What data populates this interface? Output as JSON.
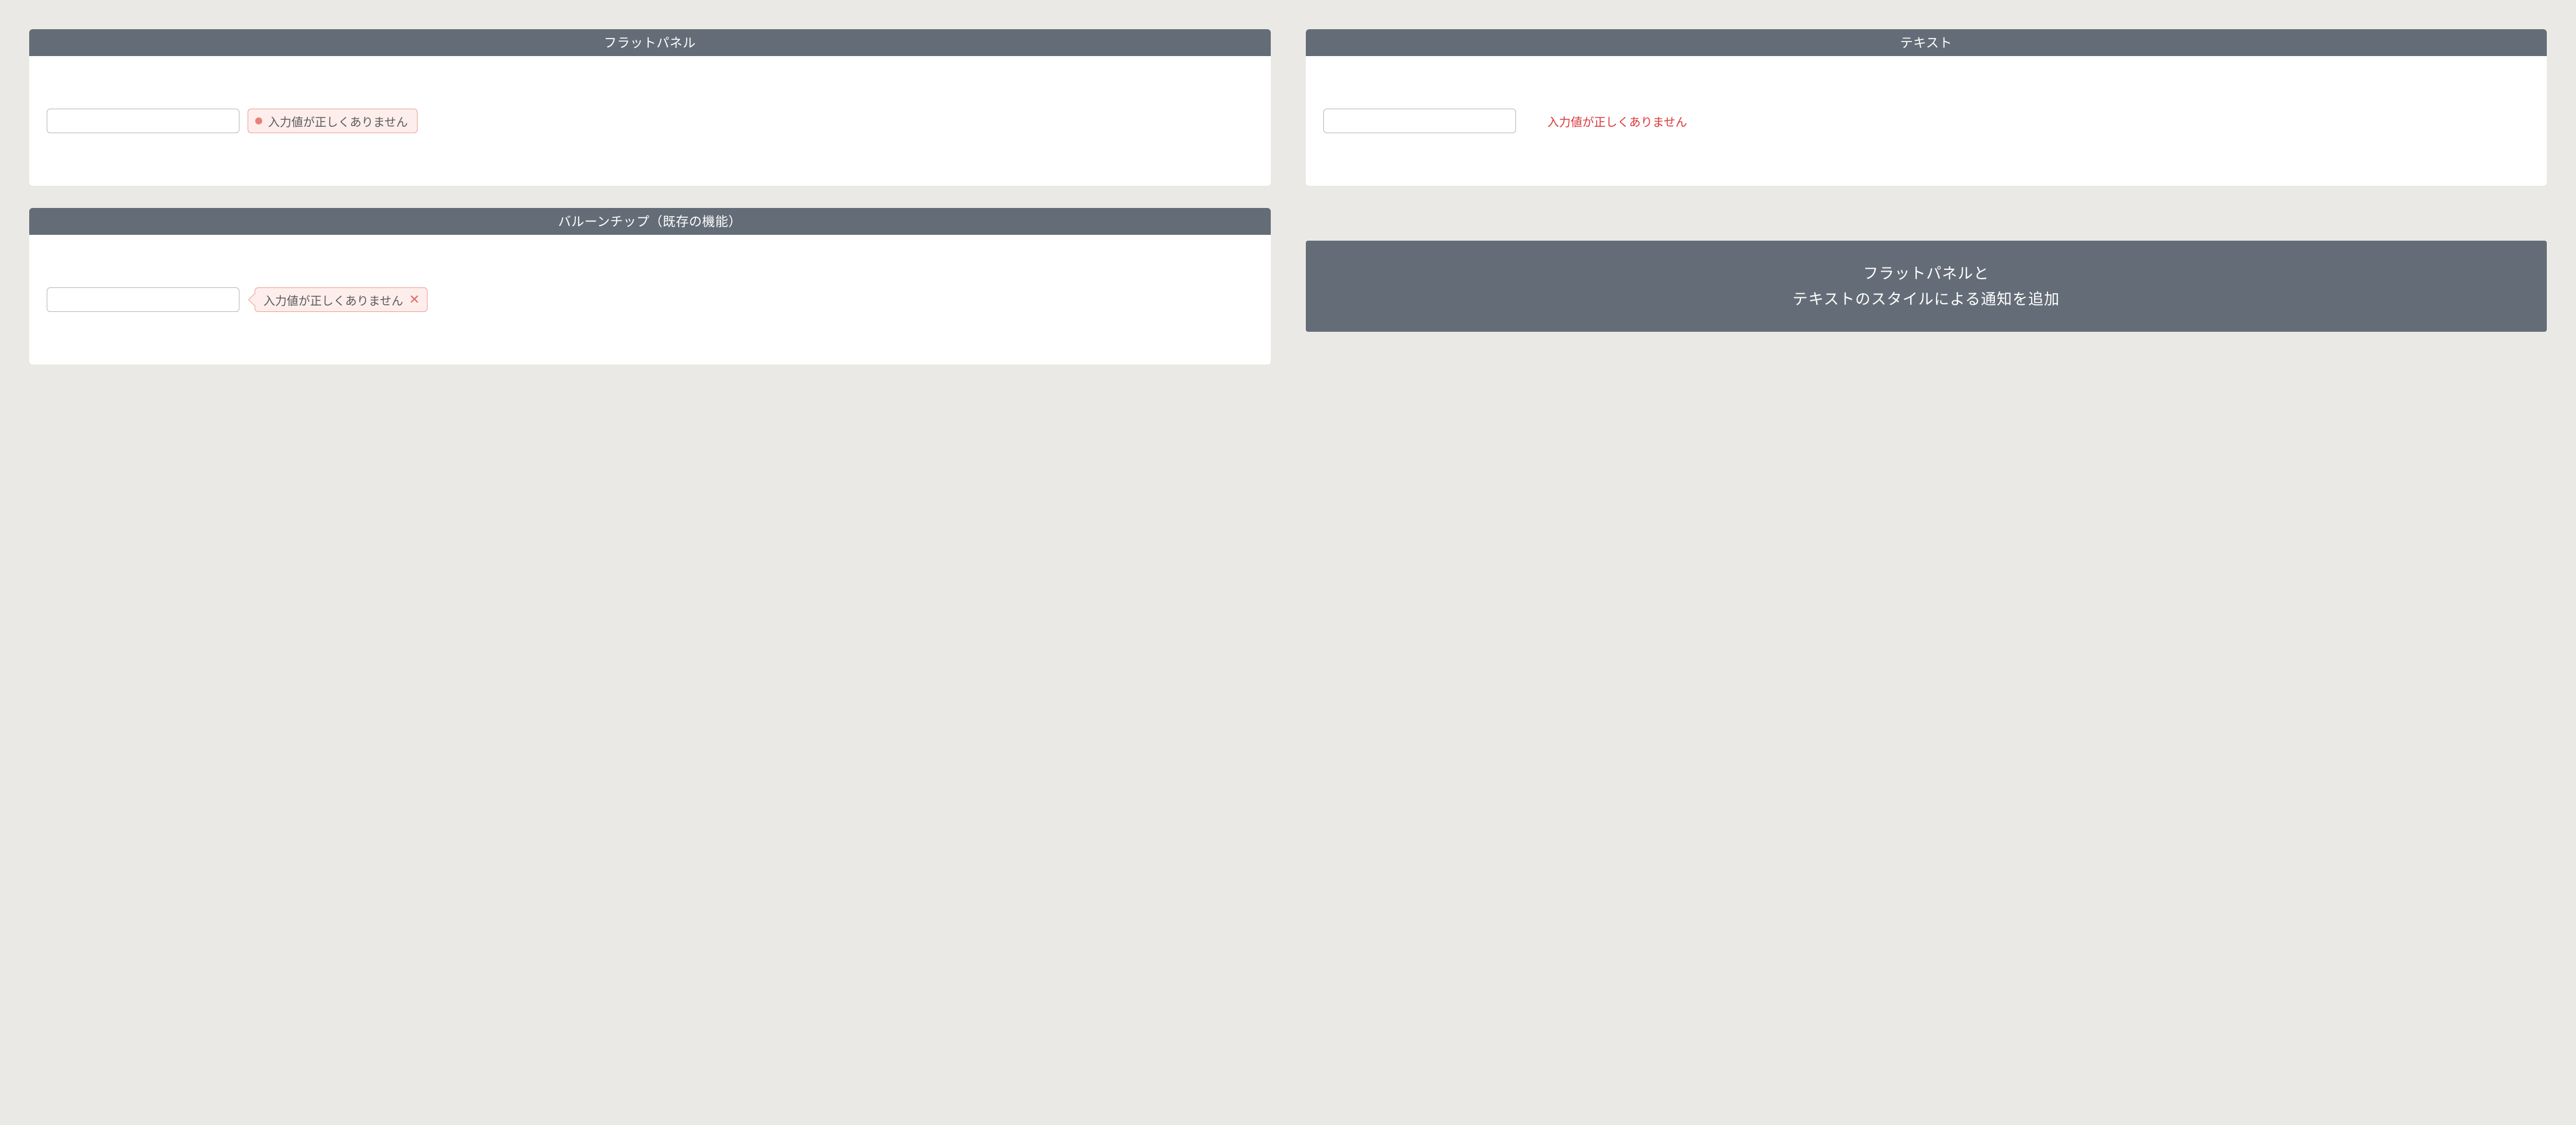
{
  "panels": {
    "flat": {
      "title": "フラットパネル",
      "error": "入力値が正しくありません"
    },
    "text": {
      "title": "テキスト",
      "error": "入力値が正しくありません"
    },
    "balloon": {
      "title": "バルーンチップ（既存の機能）",
      "error": "入力値が正しくありません"
    }
  },
  "summary": {
    "line1": "フラットパネルと",
    "line2": "テキストのスタイルによる通知を追加"
  },
  "colors": {
    "panel_header_bg": "#646d77",
    "error_border": "#ee9c93",
    "error_bg": "#fdeeec",
    "error_text_red": "#d9383a",
    "page_bg": "#ebe9e6"
  }
}
